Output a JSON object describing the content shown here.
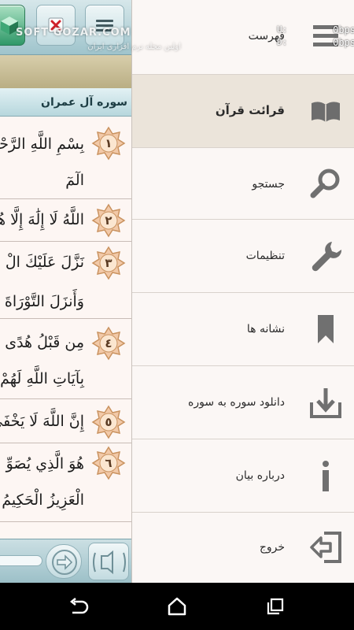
{
  "reader": {
    "surah_title": "سوره آل عمران",
    "verses": [
      {
        "num": "١",
        "text": "بِسْمِ اللَّهِ الرَّحْمَٰ",
        "text2": "الٓمٓ"
      },
      {
        "num": "٢",
        "text": "اللَّهُ لَا إِلَٰهَ إِلَّا هُوَ",
        "text2": ""
      },
      {
        "num": "٣",
        "text": "نَزَّلَ عَلَيْكَ الْ",
        "text2": "وَأَنزَلَ التَّوْرَاةَ وَالْإِن"
      },
      {
        "num": "٤",
        "text": "مِن قَبْلُ هُدًى لِّ",
        "text2": "بِآيَاتِ اللَّهِ لَهُمْ عَذَابٌ شَ"
      },
      {
        "num": "٥",
        "text": "إِنَّ اللَّهَ لَا يَخْفَىٰ",
        "text2": ""
      },
      {
        "num": "٦",
        "text": "هُوَ الَّذِي يُصَوِّ",
        "text2": "الْعَزِيزُ الْحَكِيمُ"
      }
    ]
  },
  "drawer": {
    "items": [
      {
        "label": "فهرست",
        "icon": "list-icon"
      },
      {
        "label": "قرائت قرآن",
        "icon": "book-icon"
      },
      {
        "label": "جستجو",
        "icon": "search-icon"
      },
      {
        "label": "تنظیمات",
        "icon": "wrench-icon"
      },
      {
        "label": "نشانه ها",
        "icon": "bookmark-icon"
      },
      {
        "label": "دانلود سوره به سوره",
        "icon": "download-icon"
      },
      {
        "label": "درباره بیان",
        "icon": "info-icon"
      },
      {
        "label": "خروج",
        "icon": "exit-icon"
      }
    ]
  },
  "status": {
    "upload": "0bps",
    "download": "0bps",
    "u_label": "U:",
    "d_label": "D:"
  },
  "watermark": {
    "brand": "SOFT GOZAR.COM",
    "sub": "اولین مجله نرم افزاری ایران"
  },
  "colors": {
    "accent_teal": "#9fc4cc",
    "active_item": "#ebe4da",
    "icon_gray": "#707070"
  }
}
